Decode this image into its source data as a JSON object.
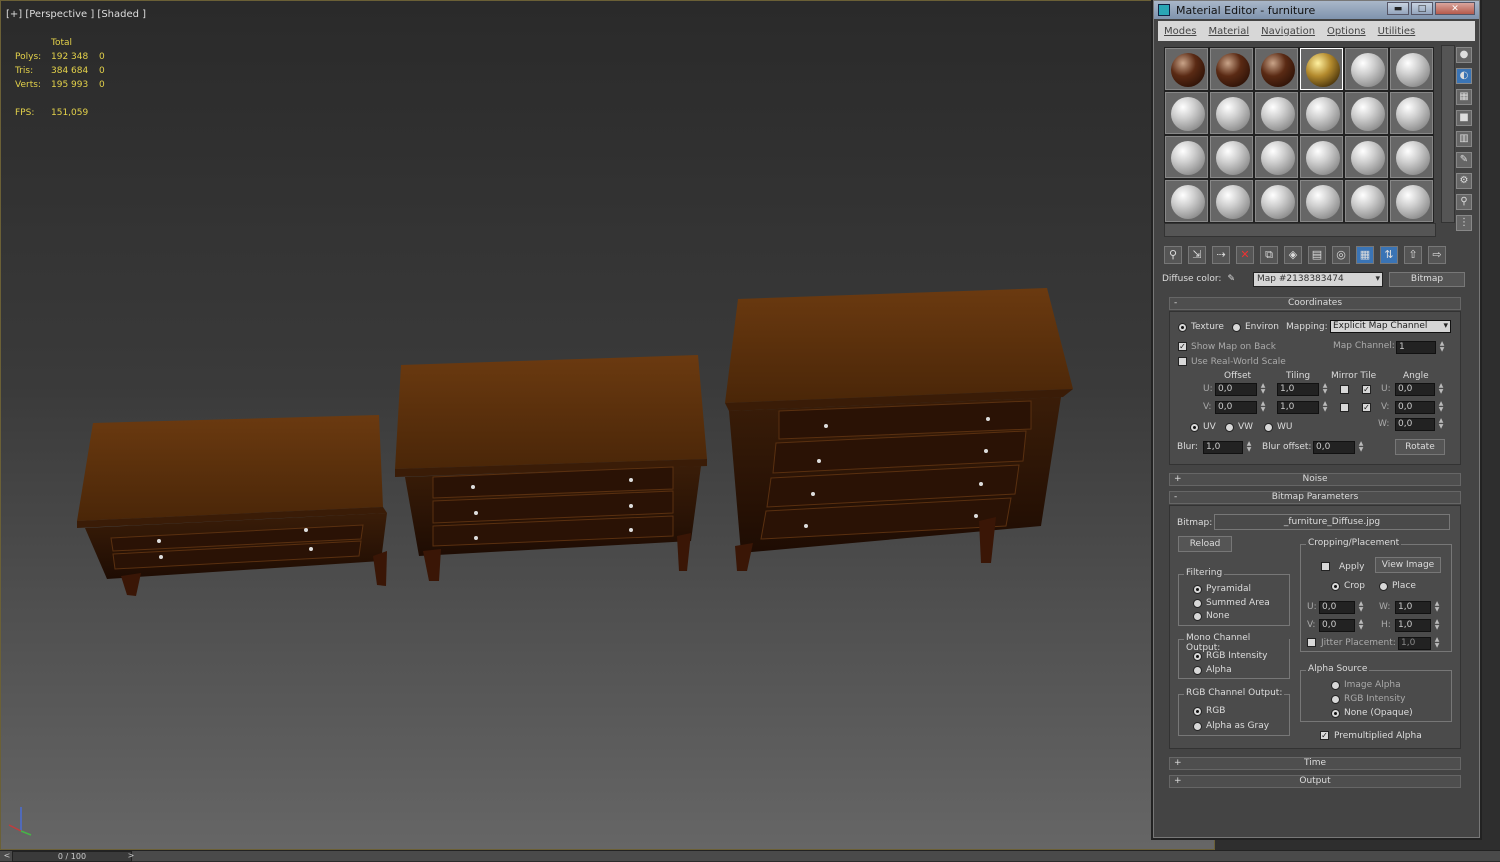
{
  "viewport": {
    "label": "[+] [Perspective ] [Shaded ]",
    "stats": {
      "header": "Total",
      "rows": [
        {
          "k": "Polys:",
          "v": "192 348",
          "s": "0"
        },
        {
          "k": "Tris:",
          "v": "384 684",
          "s": "0"
        },
        {
          "k": "Verts:",
          "v": "195 993",
          "s": "0"
        }
      ],
      "fps_label": "FPS:",
      "fps_value": "151,059"
    }
  },
  "timeline": {
    "frame": "0 / 100",
    "prev": "<",
    "next": ">"
  },
  "material_editor": {
    "title": "Material Editor - furniture",
    "window_buttons": {
      "min": "▬",
      "max": "□",
      "close": "✕"
    },
    "menu": [
      "Modes",
      "Material",
      "Navigation",
      "Options",
      "Utilities"
    ],
    "diffuse_label": "Diffuse color:",
    "map_name": "Map #2138383474",
    "map_type": "Bitmap",
    "coordinates": {
      "title": "Coordinates",
      "texture": "Texture",
      "environ": "Environ",
      "mapping_label": "Mapping:",
      "mapping_value": "Explicit Map Channel",
      "show_map_on_back": "Show Map on Back",
      "map_channel_label": "Map Channel:",
      "map_channel_value": "1",
      "real_world": "Use Real-World Scale",
      "offset": "Offset",
      "tiling": "Tiling",
      "mirror_tile": "Mirror Tile",
      "angle": "Angle",
      "u": "U:",
      "v": "V:",
      "w": "W:",
      "u_offset": "0,0",
      "v_offset": "0,0",
      "u_tiling": "1,0",
      "v_tiling": "1,0",
      "u_angle": "0,0",
      "v_angle": "0,0",
      "w_angle": "0,0",
      "uv": "UV",
      "vw": "VW",
      "wu": "WU",
      "blur_label": "Blur:",
      "blur_value": "1,0",
      "blur_offset_label": "Blur offset:",
      "blur_offset_value": "0,0",
      "rotate": "Rotate"
    },
    "noise": "Noise",
    "bitmap_params": {
      "title": "Bitmap Parameters",
      "bitmap_label": "Bitmap:",
      "bitmap_file": "_furniture_Diffuse.jpg",
      "reload": "Reload",
      "cropping": "Cropping/Placement",
      "apply": "Apply",
      "view_image": "View Image",
      "crop": "Crop",
      "place": "Place",
      "u_label": "U:",
      "v_label": "V:",
      "w_label": "W:",
      "h_label": "H:",
      "u_val": "0,0",
      "v_val": "0,0",
      "w_val": "1,0",
      "h_val": "1,0",
      "jitter_label": "Jitter Placement:",
      "jitter_val": "1,0",
      "filtering": "Filtering",
      "pyramidal": "Pyramidal",
      "summed_area": "Summed Area",
      "none": "None",
      "mono_output": "Mono Channel Output:",
      "rgb_intensity": "RGB Intensity",
      "alpha": "Alpha",
      "rgb_output": "RGB Channel Output:",
      "rgb": "RGB",
      "alpha_as_gray": "Alpha as Gray",
      "alpha_source": "Alpha Source",
      "image_alpha": "Image Alpha",
      "rgb_intensity2": "RGB Intensity",
      "none_opaque": "None (Opaque)",
      "premultiplied": "Premultiplied Alpha"
    },
    "time": "Time",
    "output": "Output",
    "slot_materials": [
      "brown",
      "brown",
      "brown",
      "gold",
      "grey",
      "grey",
      "grey",
      "grey",
      "grey",
      "grey",
      "grey",
      "grey",
      "grey",
      "grey",
      "grey",
      "grey",
      "grey",
      "grey",
      "grey",
      "grey",
      "grey",
      "grey",
      "grey",
      "grey"
    ],
    "rollout_plus": "+",
    "rollout_minus": "-"
  }
}
